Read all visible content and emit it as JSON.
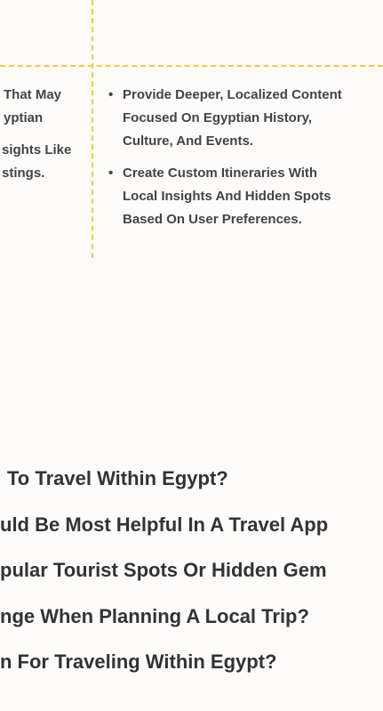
{
  "left_column": {
    "lines": [
      "That May",
      "yptian",
      "sights Like",
      "stings."
    ]
  },
  "right_column": {
    "bullets": [
      {
        "lines": [
          "Provide Deeper, Localized Content",
          "Focused On Egyptian History,",
          "Culture, And Events."
        ]
      },
      {
        "lines": [
          "Create Custom Itineraries With",
          "Local Insights And Hidden Spots",
          "Based On User Preferences."
        ]
      }
    ],
    "bullet_symbol": "•"
  },
  "questions": [
    "To Travel Within Egypt?",
    "uld Be Most Helpful In A Travel App",
    "pular Tourist Spots Or Hidden Gem",
    "nge When Planning A Local Trip?",
    "n For Traveling Within Egypt?"
  ],
  "colors": {
    "dash": "#f5c842",
    "background": "#fdfcfb",
    "text": "#3a3a3a"
  }
}
